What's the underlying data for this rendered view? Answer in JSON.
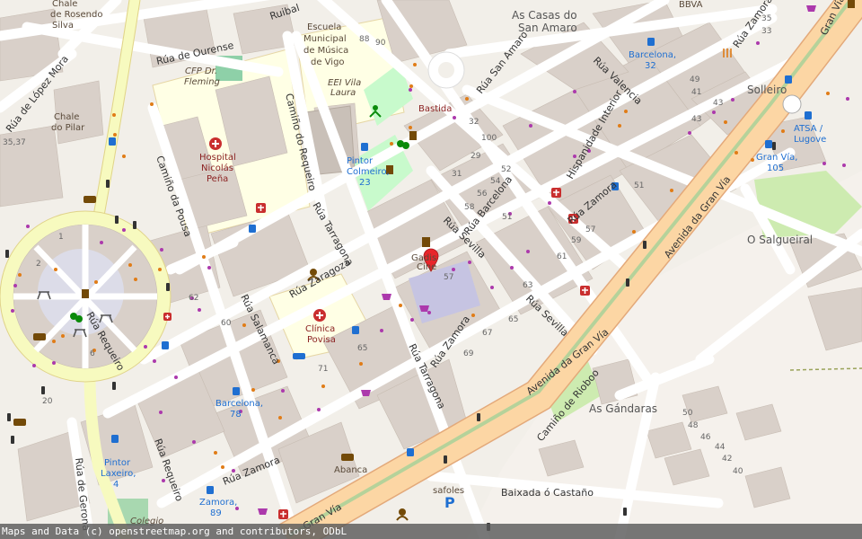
{
  "attribution": "Maps and Data (c) openstreetmap.org and contributors, ODbL",
  "colors": {
    "background": "#f2efe9",
    "building": "#d9d0c9",
    "primary_road": "#fcd6a4",
    "secondary_road": "#f7fabf",
    "residential_road": "#ffffff",
    "park": "#c8facc",
    "school": "#ffffe5",
    "marker": "#e8262b"
  },
  "streets": {
    "gran_via": "Avenida da Gran Vía",
    "gran_via_short": "Gran Vía",
    "ourense": "Rúa de Ourense",
    "ruibal": "Ruibal",
    "lopez_mora": "Rúa de López Mora",
    "camino_requeiro": "Camiño do Requeiro",
    "camino_pousa": "Camiño da Pousa",
    "tarragona_n": "Rúa Tarragona",
    "tarragona_s": "Rúa Tarragona",
    "zaragoza": "Rúa Zaragoza",
    "salamanca": "Rúa Salamanca",
    "sevilla_n": "Rúa Sevilla",
    "sevilla_s": "Rúa Sevilla",
    "barcelona": "Rúa Barcelona",
    "zamora_mid": "Rúa Zamora",
    "zamora_s": "Rúa Zamora",
    "zamora_n": "Rúa Zamora",
    "zamora_bottom": "Rúa Zamora",
    "requeiro_plaza": "Rúa Requeiro",
    "requeiro_s": "Rúa Requeiro",
    "gerona": "Rúa de Gerona",
    "san_amaro": "Rúa San Amaro",
    "valencia": "Rúa Valencia",
    "hispanidade": "Hispanidade Interior",
    "rioboo": "Camiño de Rioboo",
    "baixada": "Baixada ó Castaño"
  },
  "places": {
    "chale_rosendo": [
      "Chale",
      "de Rosendo",
      "Silva"
    ],
    "chale_pilar": [
      "Chale",
      "do Pilar"
    ],
    "cfp": [
      "CFP Dr.",
      "Fleming"
    ],
    "escuela": [
      "Escuela",
      "Municipal",
      "de Música",
      "de Vigo"
    ],
    "eei": [
      "EEI Vila",
      "Laura"
    ],
    "casas_san_amaro": [
      "As Casas do",
      "San Amaro"
    ],
    "hospital": [
      "Hospital",
      "Nicolás",
      "Peña"
    ],
    "clinica": [
      "Clínica",
      "Povisa"
    ],
    "bastida": "Bastida",
    "bbva": "BBVA",
    "gadis": [
      "Gadis",
      "Cine"
    ],
    "solleiro": "Solleiro",
    "o_salgueiral": "O Salgueiral",
    "as_gandaras": "As Gándaras",
    "abanca": "Abanca",
    "safoles": "safoles",
    "colegio": "Colegio"
  },
  "bus_stops": {
    "barcelona_32": [
      "Barcelona,",
      "32"
    ],
    "pintor_colmeiro": [
      "Pintor",
      "Colmeiro,",
      "23"
    ],
    "atsa": [
      "ATSA /",
      "Lugove"
    ],
    "gran_via_105": [
      "Gran Vía,",
      "105"
    ],
    "barcelona_78": [
      "Barcelona,",
      "78"
    ],
    "pintor_laxeiro": [
      "Pintor",
      "Laxeiro,",
      "4"
    ],
    "zamora_89": [
      "Zamora,",
      "89"
    ]
  },
  "house_numbers": {
    "n88": "88",
    "n90": "90",
    "n32": "32",
    "n100": "100",
    "n29": "29",
    "n31": "31",
    "n52": "52",
    "n54": "54",
    "n56": "56",
    "n58": "58",
    "n51a": "51",
    "n57a": "57",
    "n59": "59",
    "n61": "61",
    "n63": "63",
    "n65": "65",
    "n67": "67",
    "n69": "69",
    "n57b": "57",
    "n51b": "51",
    "n71": "71",
    "n65b": "65",
    "n60": "60",
    "n62": "62",
    "n35": "35",
    "n33": "33",
    "n49": "49",
    "n41": "41",
    "n43a": "43",
    "n43b": "43",
    "n50": "50",
    "n48": "48",
    "n46": "46",
    "n44": "44",
    "n42": "42",
    "n40": "40",
    "n1": "1",
    "n2": "2",
    "n6": "6",
    "n20": "20",
    "n3537": "35,37"
  }
}
